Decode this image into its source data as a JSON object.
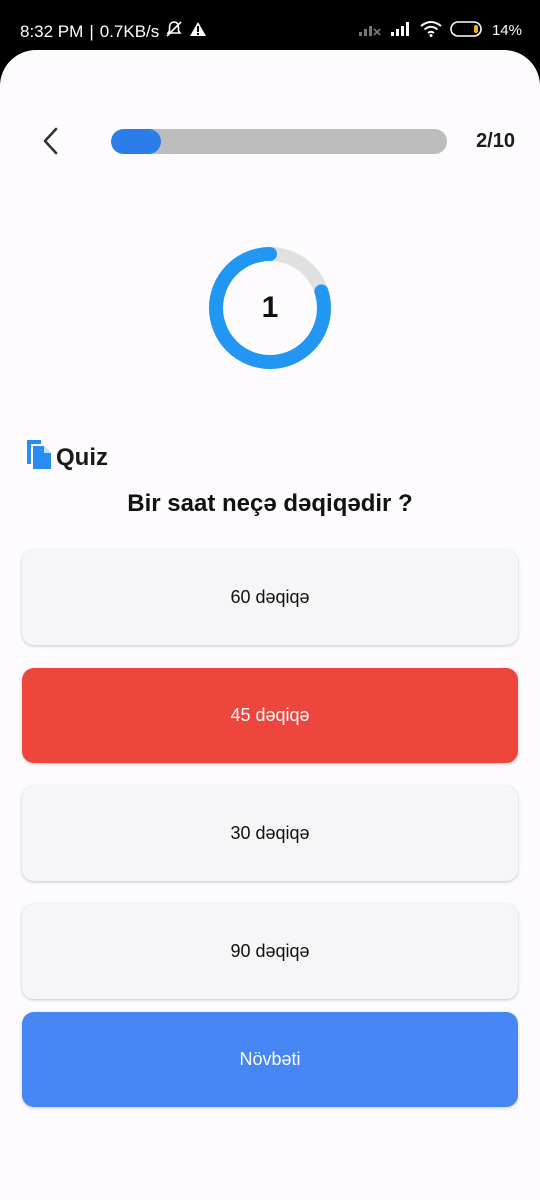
{
  "status_bar": {
    "time": "8:32 PM",
    "separator": "|",
    "network_speed": "0.7KB/s",
    "battery": "14%"
  },
  "header": {
    "progress_label": "2/10",
    "progress_fraction": 0.15
  },
  "timer": {
    "value": "1",
    "remaining_fraction": 0.8
  },
  "quiz": {
    "label": "Quiz",
    "question": "Bir saat neçə dəqiqədir ?",
    "options": [
      {
        "label": "60 dəqiqə",
        "state": "default"
      },
      {
        "label": "45 dəqiqə",
        "state": "wrong"
      },
      {
        "label": "30 dəqiqə",
        "state": "default"
      },
      {
        "label": "90 dəqiqə",
        "state": "default"
      }
    ],
    "next_label": "Növbəti"
  },
  "colors": {
    "accent": "#2b7de9",
    "timer_ring": "#2196f3",
    "wrong": "#ee453d",
    "next_button": "#4686f5"
  }
}
